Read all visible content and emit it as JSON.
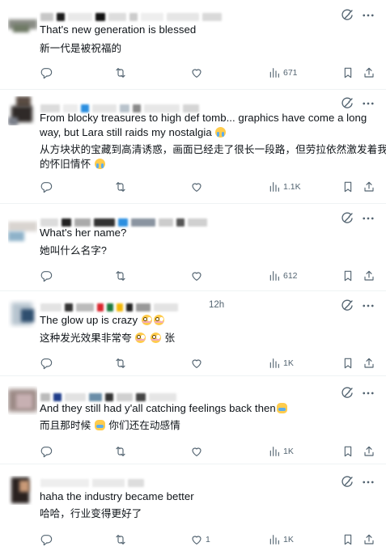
{
  "tweets": [
    {
      "text": "That's new generation is blessed",
      "translation": "新一代是被祝福的",
      "views": "671",
      "replies": "",
      "reposts": "",
      "likes": ""
    },
    {
      "text_line1": "From blocky treasures to high def tomb... graphics have come a long",
      "text_line2": "way, but Lara still raids my nostalgia",
      "translation_line1": "从方块状的宝藏到高清诱惑，画面已经走了很长一段路，但劳拉依然激发着我",
      "translation_line2": "的怀旧情怀",
      "views": "1.1K",
      "replies": "",
      "reposts": "",
      "likes": ""
    },
    {
      "text": "What's her name?",
      "translation": "她叫什么名字?",
      "views": "612",
      "replies": "",
      "reposts": "",
      "likes": ""
    },
    {
      "text": "The glow up is crazy",
      "translation_a": "这种发光效果非常夸",
      "translation_b": "张",
      "header_time": "12h",
      "views": "1K",
      "replies": "",
      "reposts": "",
      "likes": ""
    },
    {
      "text": "And they still had y'all catching feelings back then",
      "translation_a": "而且那时候",
      "translation_b": "你们还在动感情",
      "views": "1K",
      "replies": "",
      "reposts": "",
      "likes": ""
    },
    {
      "text": "haha the industry became better",
      "translation": "哈哈，行业变得更好了",
      "views": "1K",
      "replies": "",
      "reposts": "",
      "likes": "1"
    }
  ],
  "icons": {
    "reply": "reply-icon",
    "repost": "repost-icon",
    "like": "like-icon",
    "views": "views-icon",
    "bookmark": "bookmark-icon",
    "share": "share-icon",
    "grok": "grok-icon",
    "more": "more-icon"
  },
  "colors": {
    "icon_gray": "#536471",
    "text": "#0f1419",
    "divider": "#eff3f4",
    "emoji_yellow": "#ffcc4d"
  }
}
